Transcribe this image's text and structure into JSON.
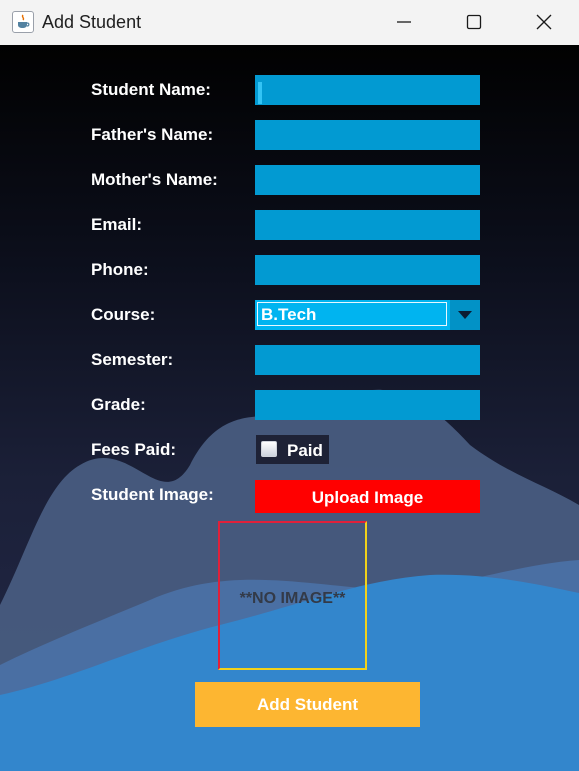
{
  "window": {
    "title": "Add Student",
    "controls": [
      "minimize",
      "maximize",
      "close"
    ]
  },
  "form": {
    "labels": {
      "student_name": "Student Name:",
      "father_name": "Father's Name:",
      "mother_name": "Mother's Name:",
      "email": "Email:",
      "phone": "Phone:",
      "course": "Course:",
      "semester": "Semester:",
      "grade": "Grade:",
      "fees_paid": "Fees Paid:",
      "student_image": "Student Image:"
    },
    "values": {
      "student_name": "",
      "father_name": "",
      "mother_name": "",
      "email": "",
      "phone": "",
      "semester": "",
      "grade": ""
    },
    "course": {
      "selected": "B.Tech"
    },
    "fees_paid": {
      "checkbox_label": "Paid",
      "checked": false
    },
    "upload_button": "Upload Image",
    "image_placeholder": "**NO IMAGE**",
    "submit_button": "Add Student"
  },
  "colors": {
    "input_bg": "#029ad2",
    "select_bg": "#00b4f0",
    "upload_button": "#ff0000",
    "submit_button": "#fdb631",
    "wave_light": "#3386cc"
  },
  "icons": {
    "app": "java-cup-icon",
    "dropdown": "chevron-down-icon"
  }
}
